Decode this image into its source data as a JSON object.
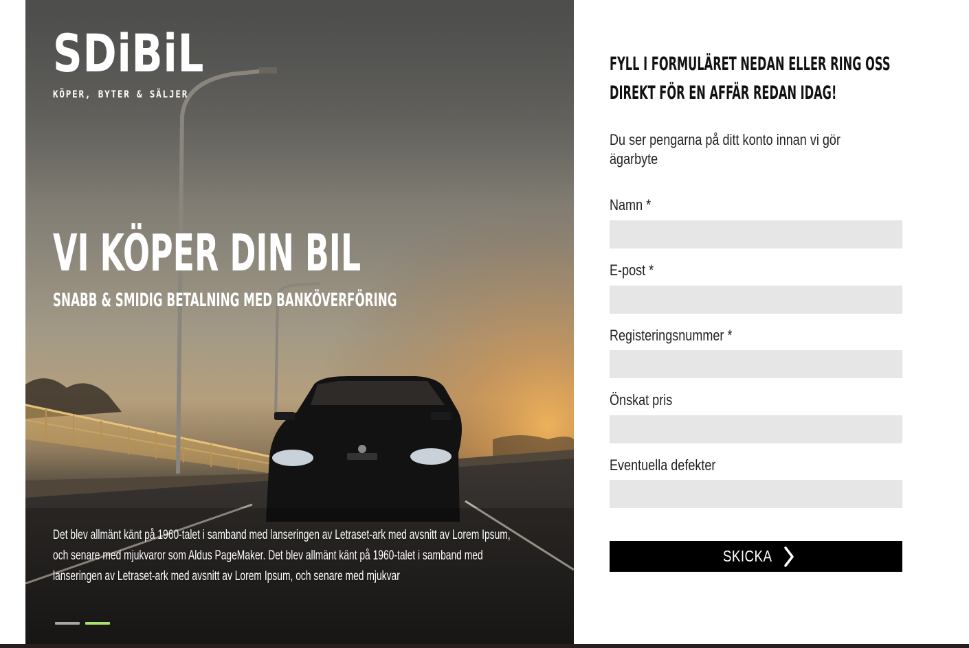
{
  "hero": {
    "logo_name": "SDiBiL",
    "logo_tagline": "KÖPER, BYTER & SÄLJER",
    "title": "VI KÖPER DIN BIL",
    "subtitle": "SNABB & SMIDIG BETALNING MED BANKÖVERFÖRING",
    "body": "Det blev allmänt känt på 1960-talet i samband med lanseringen av Letraset-ark med avsnitt av Lorem Ipsum, och senare med mjukvaror som Aldus PageMaker. Det blev allmänt känt på 1960-talet i samband med lanseringen av Letraset-ark med avsnitt av Lorem Ipsum, och senare med mjukvar",
    "slider": {
      "count": 2,
      "active_index": 1,
      "active_color": "#a7e36a",
      "inactive_color": "#a7a7a7"
    }
  },
  "form": {
    "heading_line1": "FYLL I FORMULÄRET NEDAN ELLER RING OSS",
    "heading_line2": "DIREKT FÖR EN AFFÄR REDAN IDAG!",
    "intro": "Du ser pengarna på ditt konto innan vi gör ägarbyte",
    "fields": [
      {
        "label": "Namn *",
        "value": ""
      },
      {
        "label": "E-post *",
        "value": ""
      },
      {
        "label": "Registeringsnummer *",
        "value": ""
      },
      {
        "label": "Önskat pris",
        "value": ""
      },
      {
        "label": "Eventuella defekter",
        "value": ""
      }
    ],
    "submit_label": "SKICKA",
    "submit_icon": "chevron-right-icon"
  },
  "colors": {
    "input_background": "#e6e6e6",
    "button_background": "#000000",
    "text": "#222222"
  }
}
